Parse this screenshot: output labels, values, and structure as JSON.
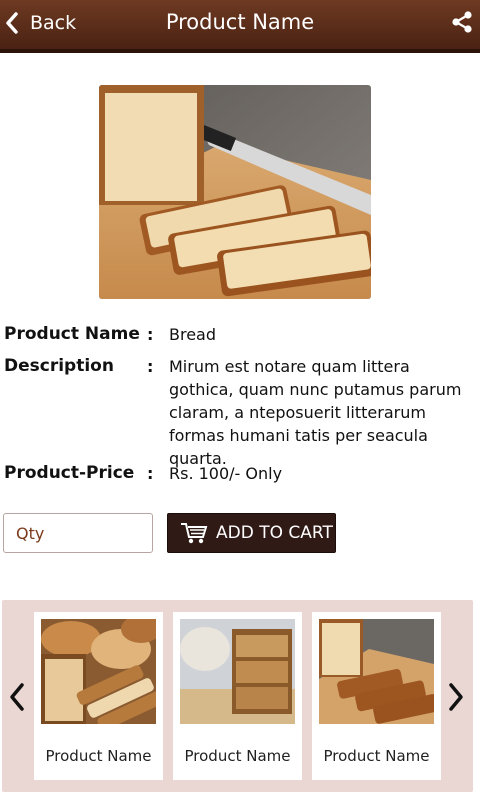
{
  "header": {
    "back_label": "Back",
    "title": "Product Name",
    "share_icon": "share-icon",
    "back_icon": "chevron-left-icon",
    "background": "#5a2c18"
  },
  "product": {
    "name_label": "Product Name",
    "name_value": "Bread",
    "description_label": "Description",
    "description_value": "Mirum est notare quam littera gothica, quam nunc putamus parum claram, a nteposuerit litterarum formas humani tatis per seacula quarta.",
    "price_label": "Product-Price",
    "price_value": "Rs. 100/- Only",
    "separator": ":"
  },
  "actions": {
    "qty_placeholder": "Qty",
    "add_to_cart_label": "ADD TO CART",
    "cart_icon": "shopping-cart-icon",
    "button_color": "#2f1a15"
  },
  "related": {
    "background": "#ead6d2",
    "prev_icon": "chevron-left-icon",
    "next_icon": "chevron-right-icon",
    "items": [
      {
        "name": "Product Name"
      },
      {
        "name": "Product Name"
      },
      {
        "name": "Product Name"
      }
    ]
  }
}
